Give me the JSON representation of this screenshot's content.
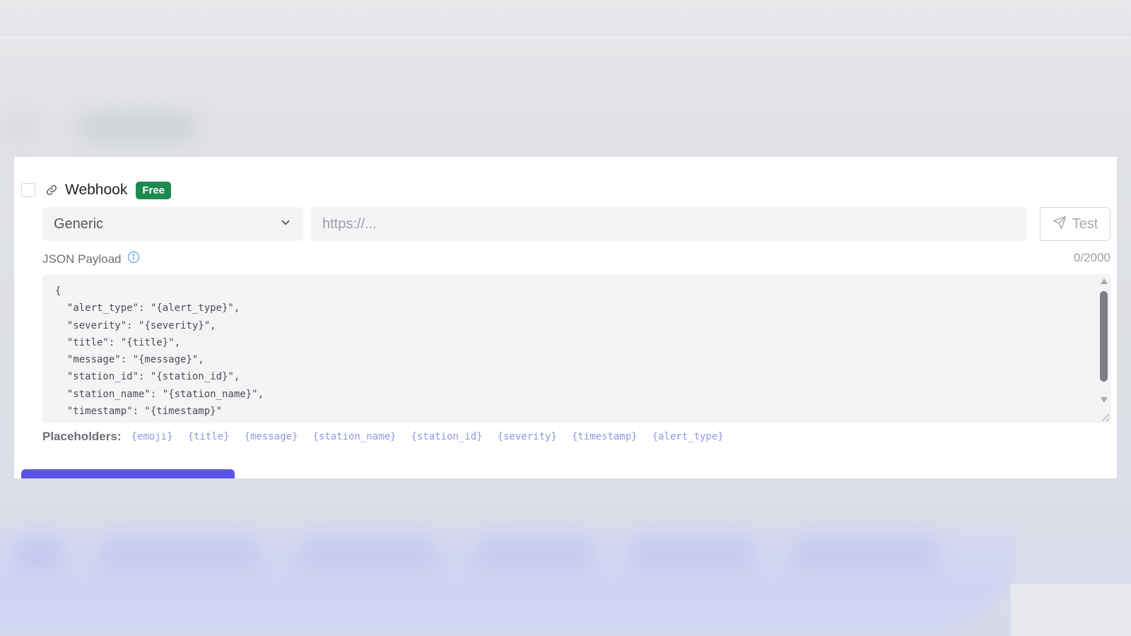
{
  "colors": {
    "badge_bg": "#1e8a4f",
    "primary_button": "#5b55e6",
    "placeholder_chip_text": "#8f98e0",
    "info_icon": "#5aa0e8"
  },
  "webhook": {
    "title": "Webhook",
    "badge": "Free",
    "icon": "link-icon",
    "enabled": false
  },
  "format_select": {
    "value": "Generic",
    "icon": "chevron-down-icon"
  },
  "url_input": {
    "placeholder": "https://...",
    "value": ""
  },
  "test_button": {
    "label": "Test",
    "icon": "send-icon"
  },
  "payload": {
    "label": "JSON Payload",
    "info_icon": "info-icon",
    "counter": "0/2000",
    "code": "{\n  \"alert_type\": \"{alert_type}\",\n  \"severity\": \"{severity}\",\n  \"title\": \"{title}\",\n  \"message\": \"{message}\",\n  \"station_id\": \"{station_id}\",\n  \"station_name\": \"{station_name}\",\n  \"timestamp\": \"{timestamp}\"\n}"
  },
  "placeholders": {
    "label": "Placeholders:",
    "items": [
      "{emoji}",
      "{title}",
      "{message}",
      "{station_name}",
      "{station_id}",
      "{severity}",
      "{timestamp}",
      "{alert_type}"
    ]
  }
}
